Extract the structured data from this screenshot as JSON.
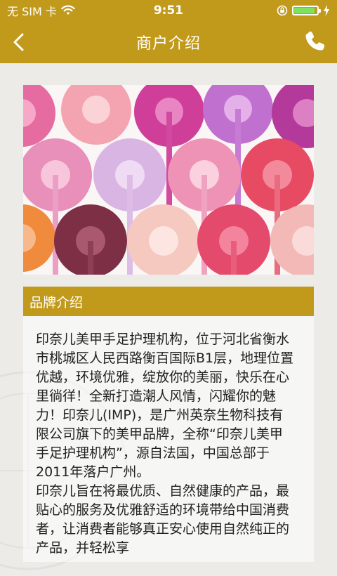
{
  "status_bar": {
    "carrier": "无 SIM 卡",
    "time": "9:51",
    "battery_level": 0.9,
    "icons": [
      "wifi-icon",
      "orientation-lock-icon",
      "battery-icon",
      "charging-icon"
    ]
  },
  "nav": {
    "title": "商户介绍",
    "back_icon": "chevron-left-icon",
    "phone_icon": "phone-icon"
  },
  "hero": {
    "alt": "nail polish swatches",
    "icon": "hero-image"
  },
  "section": {
    "title": "品牌介绍"
  },
  "content": {
    "paragraph_1": "印奈儿美甲手足护理机构，位于河北省衡水市桃城区人民西路衡百国际B1层，地理位置优越，环境优雅，绽放你的美丽，快乐在心里徜徉！全新打造潮人风情，闪耀你的魅力！印奈儿(IMP)，是广州英奈生物科技有限公司旗下的美甲品牌，全称“印奈儿美甲手足护理机构”，源自法国，中国总部于2011年落户广州。",
    "paragraph_2": "印奈儿旨在将最优质、自然健康的产品，最贴心的服务及优雅舒适的环境带给中国消费者，让消费者能够真正安心使用自然纯正的产品，并轻松享"
  },
  "colors": {
    "brand": "#c19a1c",
    "background": "#ecebe8",
    "text": "#222222"
  }
}
